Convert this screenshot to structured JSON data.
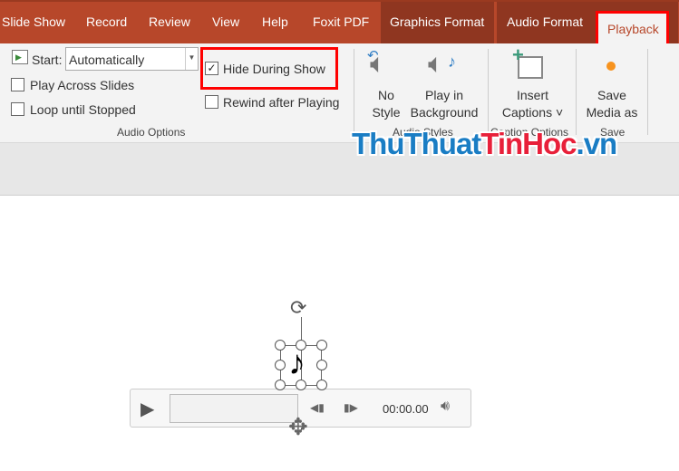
{
  "tabs": [
    {
      "label": "Slide Show"
    },
    {
      "label": "Record"
    },
    {
      "label": "Review"
    },
    {
      "label": "View"
    },
    {
      "label": "Help"
    },
    {
      "label": "Foxit PDF"
    },
    {
      "label": "Graphics Format"
    },
    {
      "label": "Audio Format"
    },
    {
      "label": "Playback",
      "active": true
    }
  ],
  "audio_options": {
    "start_label": "Start:",
    "start_value": "Automatically",
    "hide_during_show": {
      "label": "Hide During Show",
      "checked": true
    },
    "play_across_slides": {
      "label": "Play Across Slides",
      "checked": false
    },
    "loop_until_stopped": {
      "label": "Loop until Stopped",
      "checked": false
    },
    "rewind_after_playing": {
      "label": "Rewind after Playing",
      "checked": false
    },
    "group_label": "Audio Options"
  },
  "audio_styles": {
    "no_style": "No\nStyle",
    "no_style_l1": "No",
    "no_style_l2": "Style",
    "play_bg_l1": "Play in",
    "play_bg_l2": "Background",
    "group_label": "Audio Styles"
  },
  "caption_options": {
    "insert_l1": "Insert",
    "insert_l2": "Captions",
    "group_label": "Caption Options"
  },
  "save": {
    "save_l1": "Save",
    "save_l2": "Media as",
    "group_label": "Save"
  },
  "watermark": {
    "part1": "ThuThuat",
    "part2": "TinHoc",
    "part3": ".vn"
  },
  "player": {
    "time": "00:00.00"
  },
  "colors": {
    "tabbar": "#b7472a",
    "context_tabs": "#8f3620",
    "highlight": "#ff0000",
    "watermark_blue": "#1a7dc4",
    "watermark_red": "#e8203a"
  }
}
